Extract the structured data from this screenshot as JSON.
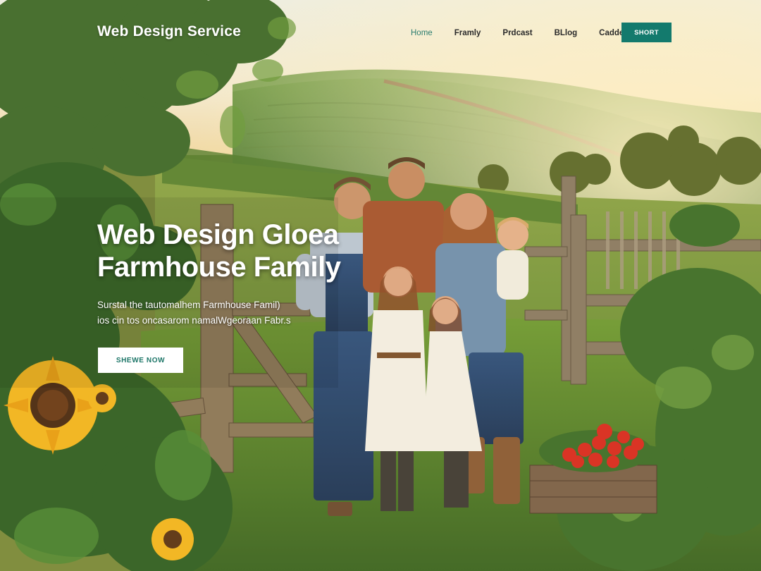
{
  "header": {
    "brand": "Web Design Service",
    "nav": [
      "Home",
      "Framly",
      "Prdcast",
      "BLlog",
      "Cadder"
    ],
    "active_index": 0,
    "cta_label": "SHORT"
  },
  "hero": {
    "title_line1": "Web Design Gloea",
    "title_line2": "Farmhouse Family",
    "subtitle_line1": "Surstal the tautomalhem Farmhouse Famil)",
    "subtitle_line2": "ios cin tos oncasarom namalWgeoraan Fabr.s",
    "button_label": "SHEWE NOW"
  },
  "colors": {
    "accent": "#137a6d",
    "nav_active": "#2c7d6f",
    "nav_text": "#2b2b2b",
    "sky": "#f2ead4",
    "hills": "#5f8a3a"
  },
  "icons": {
    "hero_image": "farm-family-photo"
  }
}
